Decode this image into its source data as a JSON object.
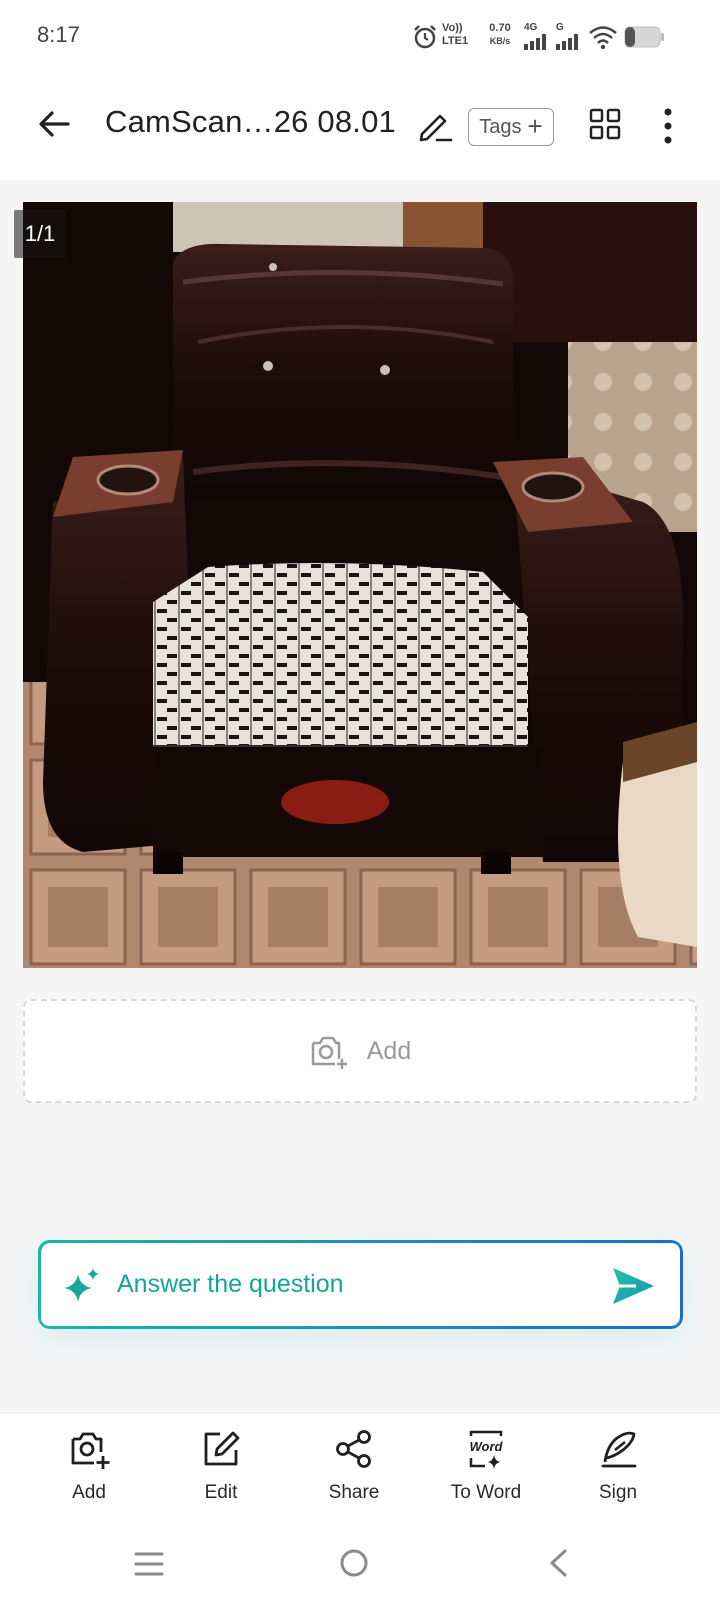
{
  "status_bar": {
    "time": "8:17",
    "volte_top": "Vo))",
    "volte_bottom": "LTE1",
    "speed_value": "0.70",
    "speed_unit": "KB/s",
    "net1": "4G",
    "net2": "G",
    "icons": [
      "alarm-icon",
      "signal-icon",
      "wifi-icon",
      "battery-icon"
    ]
  },
  "header": {
    "title": "CamScan…26 08.01",
    "tags_label": "Tags",
    "tags_plus": "+",
    "icons": [
      "back-arrow-icon",
      "pencil-icon",
      "grid-icon",
      "more-vert-icon"
    ]
  },
  "page": {
    "counter": "1/1"
  },
  "add_card": {
    "label": "Add",
    "icon": "camera-plus-icon"
  },
  "ask": {
    "placeholder": "Answer the question",
    "icons": [
      "sparkle-icon",
      "send-icon"
    ]
  },
  "toolbar": {
    "items": [
      {
        "label": "Add",
        "icon": "camera-plus-icon"
      },
      {
        "label": "Edit",
        "icon": "edit-icon"
      },
      {
        "label": "Share",
        "icon": "share-icon"
      },
      {
        "label": "To Word",
        "icon": "word-icon",
        "icon_text": "Word"
      },
      {
        "label": "Sign",
        "icon": "signature-icon"
      }
    ]
  },
  "nav": {
    "icons": [
      "menu-icon",
      "home-icon",
      "back-icon"
    ]
  },
  "colors": {
    "accent": "#1bb6a3",
    "accent_blue": "#1a6ec8",
    "background": "#f5f5f6"
  }
}
